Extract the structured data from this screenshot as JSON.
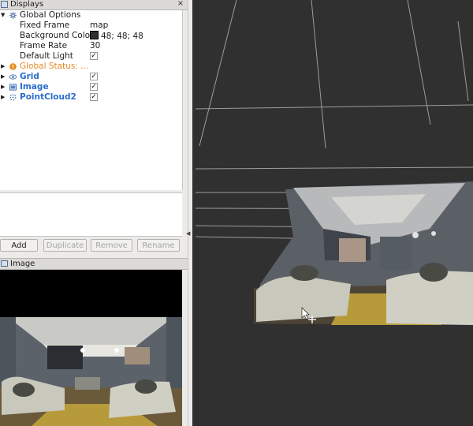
{
  "displays_panel": {
    "title": "Displays",
    "close_glyph": "×",
    "items": [
      {
        "label": "Global Options",
        "icon": "gear-icon",
        "expanded": true
      },
      {
        "label": "Fixed Frame",
        "value": "map"
      },
      {
        "label": "Background Color",
        "value": "48; 48; 48",
        "color": "#303030"
      },
      {
        "label": "Frame Rate",
        "value": "30"
      },
      {
        "label": "Default Light",
        "checked": "✓"
      },
      {
        "label": "Global Status: ...",
        "icon": "warning-icon"
      },
      {
        "label": "Grid",
        "icon": "grid-icon",
        "checked": "✓"
      },
      {
        "label": "Image",
        "icon": "image-icon",
        "checked": "✓"
      },
      {
        "label": "PointCloud2",
        "icon": "pointcloud-icon",
        "checked": "✓"
      }
    ],
    "buttons": {
      "add": "Add",
      "duplicate": "Duplicate",
      "remove": "Remove",
      "rename": "Rename"
    }
  },
  "image_panel": {
    "title": "Image"
  },
  "colors": {
    "viewport_bg": "#303030",
    "accent_blue": "#2a6ccf",
    "status_orange": "#e68a1f"
  }
}
